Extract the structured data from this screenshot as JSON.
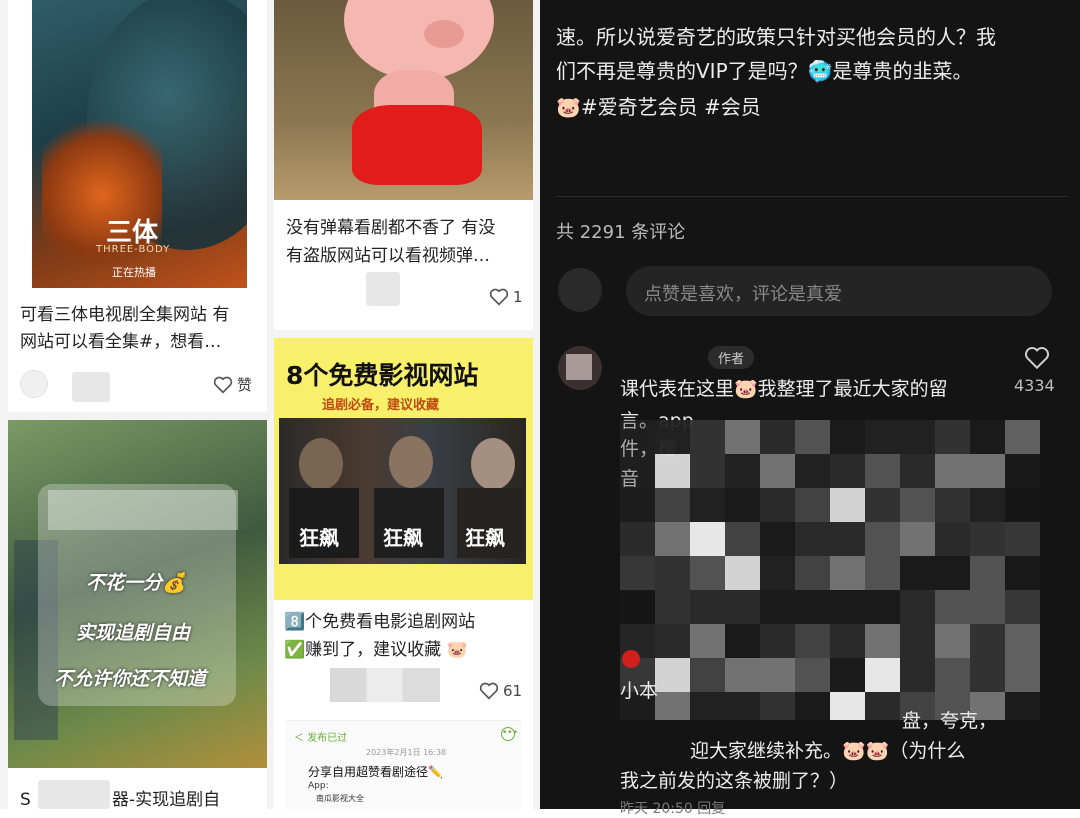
{
  "left": {
    "cards": [
      {
        "poster_title": "三体",
        "poster_subtitle": "THREE-BODY",
        "poster_tag": "正在热播",
        "caption_line1": "可看三体电视剧全集网站 有",
        "caption_line2": "网站可以看全集#，想看…",
        "likes": "赞"
      },
      {
        "caption_line1": "没有弹幕看剧都不香了 有没",
        "caption_line2": "有盗版网站可以看视频弹…",
        "likes": "1"
      },
      {
        "banner_title": "8个免费影视网站",
        "banner_sub": "追剧必备，建议收藏",
        "poster_word": "狂飙",
        "caption_line1": "8️⃣个免费看电影追剧网站",
        "caption_line2": "✅赚到了，建议收藏 🐷",
        "likes": "61",
        "preview_back": "＜ 发布已过",
        "preview_date": "2023年2月1日 16:38",
        "preview_title": "分享自用超赞看剧途径✏️",
        "preview_app": "App:",
        "preview_item": "南瓜影视大全"
      },
      {
        "overlay_line1": "不花一分💰",
        "overlay_line2": "实现追剧自由",
        "overlay_line3": "不允许你还不知道",
        "caption_partial": "S",
        "caption_rest": "器-实现追剧自"
      }
    ]
  },
  "right": {
    "post_line1": "速。所以说爱奇艺的政策只针对买他会员的人？我",
    "post_line2": "们不再是尊贵的VIP了是吗？🥶是尊贵的韭菜。",
    "post_tags": "🐷#爱奇艺会员  #会员",
    "comment_count": "共 2291 条评论",
    "comment_placeholder": "点赞是喜欢，评论是真爱",
    "author_badge": "作者",
    "like_count": "4334",
    "comment_line1": "课代表在这里🐷我整理了最近大家的留",
    "comment_line2": "言。app",
    "comment_frag1": "件，樱",
    "comment_frag2": "音",
    "comment_frag3": "小本",
    "comment_frag4": "盘，夸克，",
    "comment_line_end1": "迎大家继续补充。🐷🐷（为什么",
    "comment_line_end2": "我之前发的这条被删了？）",
    "comment_time": "昨天 20:50 回复"
  },
  "colors": {
    "dark_bg": "#141414",
    "banner_yellow": "#f5e84a",
    "accent_green": "#6cae3c"
  }
}
